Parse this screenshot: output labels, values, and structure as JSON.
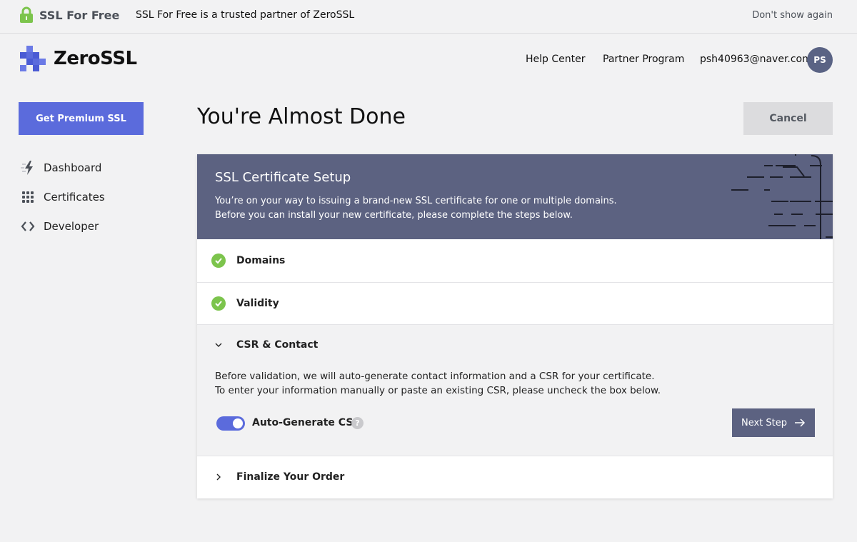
{
  "banner": {
    "brand": "SSL For Free",
    "partner_text": "SSL For Free is a trusted partner of ZeroSSL",
    "dismiss_label": "Don't show again"
  },
  "header": {
    "logo_text": "ZeroSSL",
    "nav": [
      "Help Center",
      "Partner Program"
    ],
    "user_email": "psh40963@naver.com",
    "avatar_initials": "PS"
  },
  "sidebar": {
    "premium_label": "Get Premium SSL",
    "items": [
      {
        "label": "Dashboard",
        "icon": "bolt-icon"
      },
      {
        "label": "Certificates",
        "icon": "grid-dots-icon"
      },
      {
        "label": "Developer",
        "icon": "code-brackets-icon"
      }
    ]
  },
  "main": {
    "title": "You're Almost Done",
    "cancel_label": "Cancel",
    "setup": {
      "title": "SSL Certificate Setup",
      "desc_line1": "You’re on your way to issuing a brand-new SSL certificate for one or multiple domains.",
      "desc_line2": "Before you can install your new certificate, please complete the steps below."
    },
    "steps": [
      {
        "label": "Domains",
        "status": "complete"
      },
      {
        "label": "Validity",
        "status": "complete"
      },
      {
        "label": "CSR & Contact",
        "status": "active"
      },
      {
        "label": "Finalize Your Order",
        "status": "collapsed"
      }
    ],
    "csr": {
      "desc_line1": "Before validation, we will auto-generate contact information and a CSR for your certificate.",
      "desc_line2": "To enter your information manually or paste an existing CSR, please uncheck the box below.",
      "toggle_label": "Auto-Generate CSR",
      "toggle_on": true,
      "help_glyph": "?",
      "next_label": "Next Step"
    }
  },
  "colors": {
    "accent": "#5b6bdc",
    "header_card": "#5c6281",
    "success": "#7cc44c",
    "background": "#f2f2f3"
  }
}
